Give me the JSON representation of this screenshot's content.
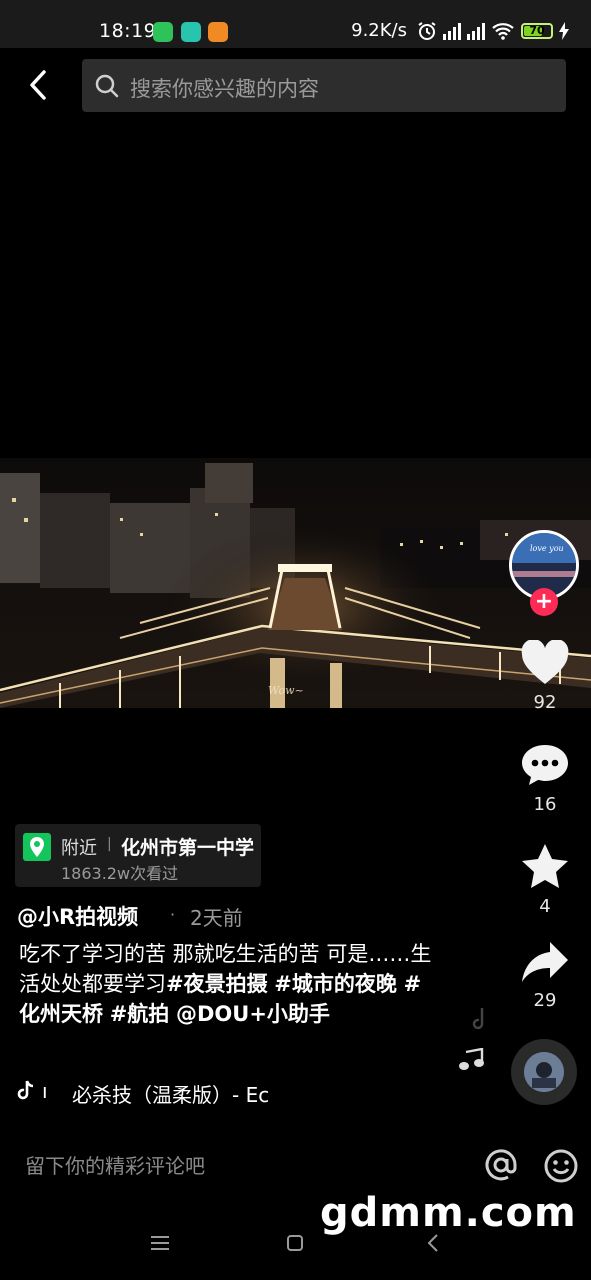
{
  "status_bar": {
    "time": "18:19",
    "network_speed": "9.2K/s",
    "battery": "70",
    "battery_level_pct": 70,
    "signal1_label": "HD",
    "signal2_label": "HD"
  },
  "search": {
    "placeholder": "搜索你感兴趣的内容"
  },
  "location": {
    "nearby": "附近",
    "name": "化州市第一中学",
    "views": "1863.2w次看过"
  },
  "author": {
    "name": "@小R拍视频",
    "time_ago": "2天前"
  },
  "caption": {
    "text": "吃不了学习的苦 那就吃生活的苦 可是……生活处处都要学习",
    "tags": [
      "#夜景拍摄",
      "#城市的夜晚",
      "#化州天桥",
      "#航拍",
      "@DOU+小助手"
    ]
  },
  "actions": {
    "likes": "92",
    "comments": "16",
    "favorites": "4",
    "shares": "29"
  },
  "music": {
    "head": "ı",
    "title": "必杀技（温柔版）- Ec"
  },
  "comment_bar": {
    "placeholder": "留下你的精彩评论吧"
  },
  "watermark": "gdmm.com",
  "video": {
    "overlay_text": "Wow~"
  },
  "avatar": {
    "text": "love you"
  }
}
